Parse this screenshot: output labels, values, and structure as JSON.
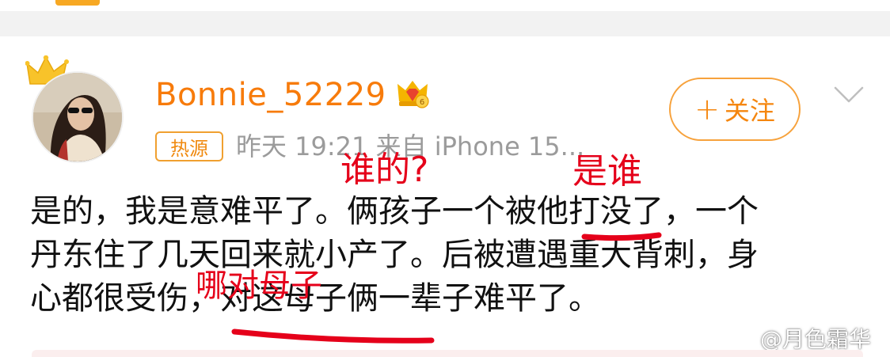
{
  "post": {
    "username": "Bonnie_52229",
    "follow_label": "关注",
    "hot_badge": "热源",
    "meta_text": "昨天 19:21 来自 iPhone 15...",
    "body_lines": [
      "是的，我是意难平了。俩孩子一个被他打没了，一个",
      "丹东住了几天回来就小产了。后被遭遇重大背刺，身",
      "心都很受伤，对这母子俩一辈子难平了。"
    ]
  },
  "annotations": {
    "whose": "谁的?",
    "who_is": "是谁",
    "which_mother_son": "哪对母子"
  },
  "watermark": {
    "text": "@月色霜华"
  },
  "colors": {
    "brand_orange": "#f77b0b",
    "annotation_red": "#e5001a",
    "meta_gray": "#9b9b9b"
  },
  "icons": {
    "avatar_crown": "crown-icon",
    "vip_badge": "vip-crown-icon",
    "more": "chevron-down-icon",
    "weibo_logo": "weibo-logo-icon"
  }
}
